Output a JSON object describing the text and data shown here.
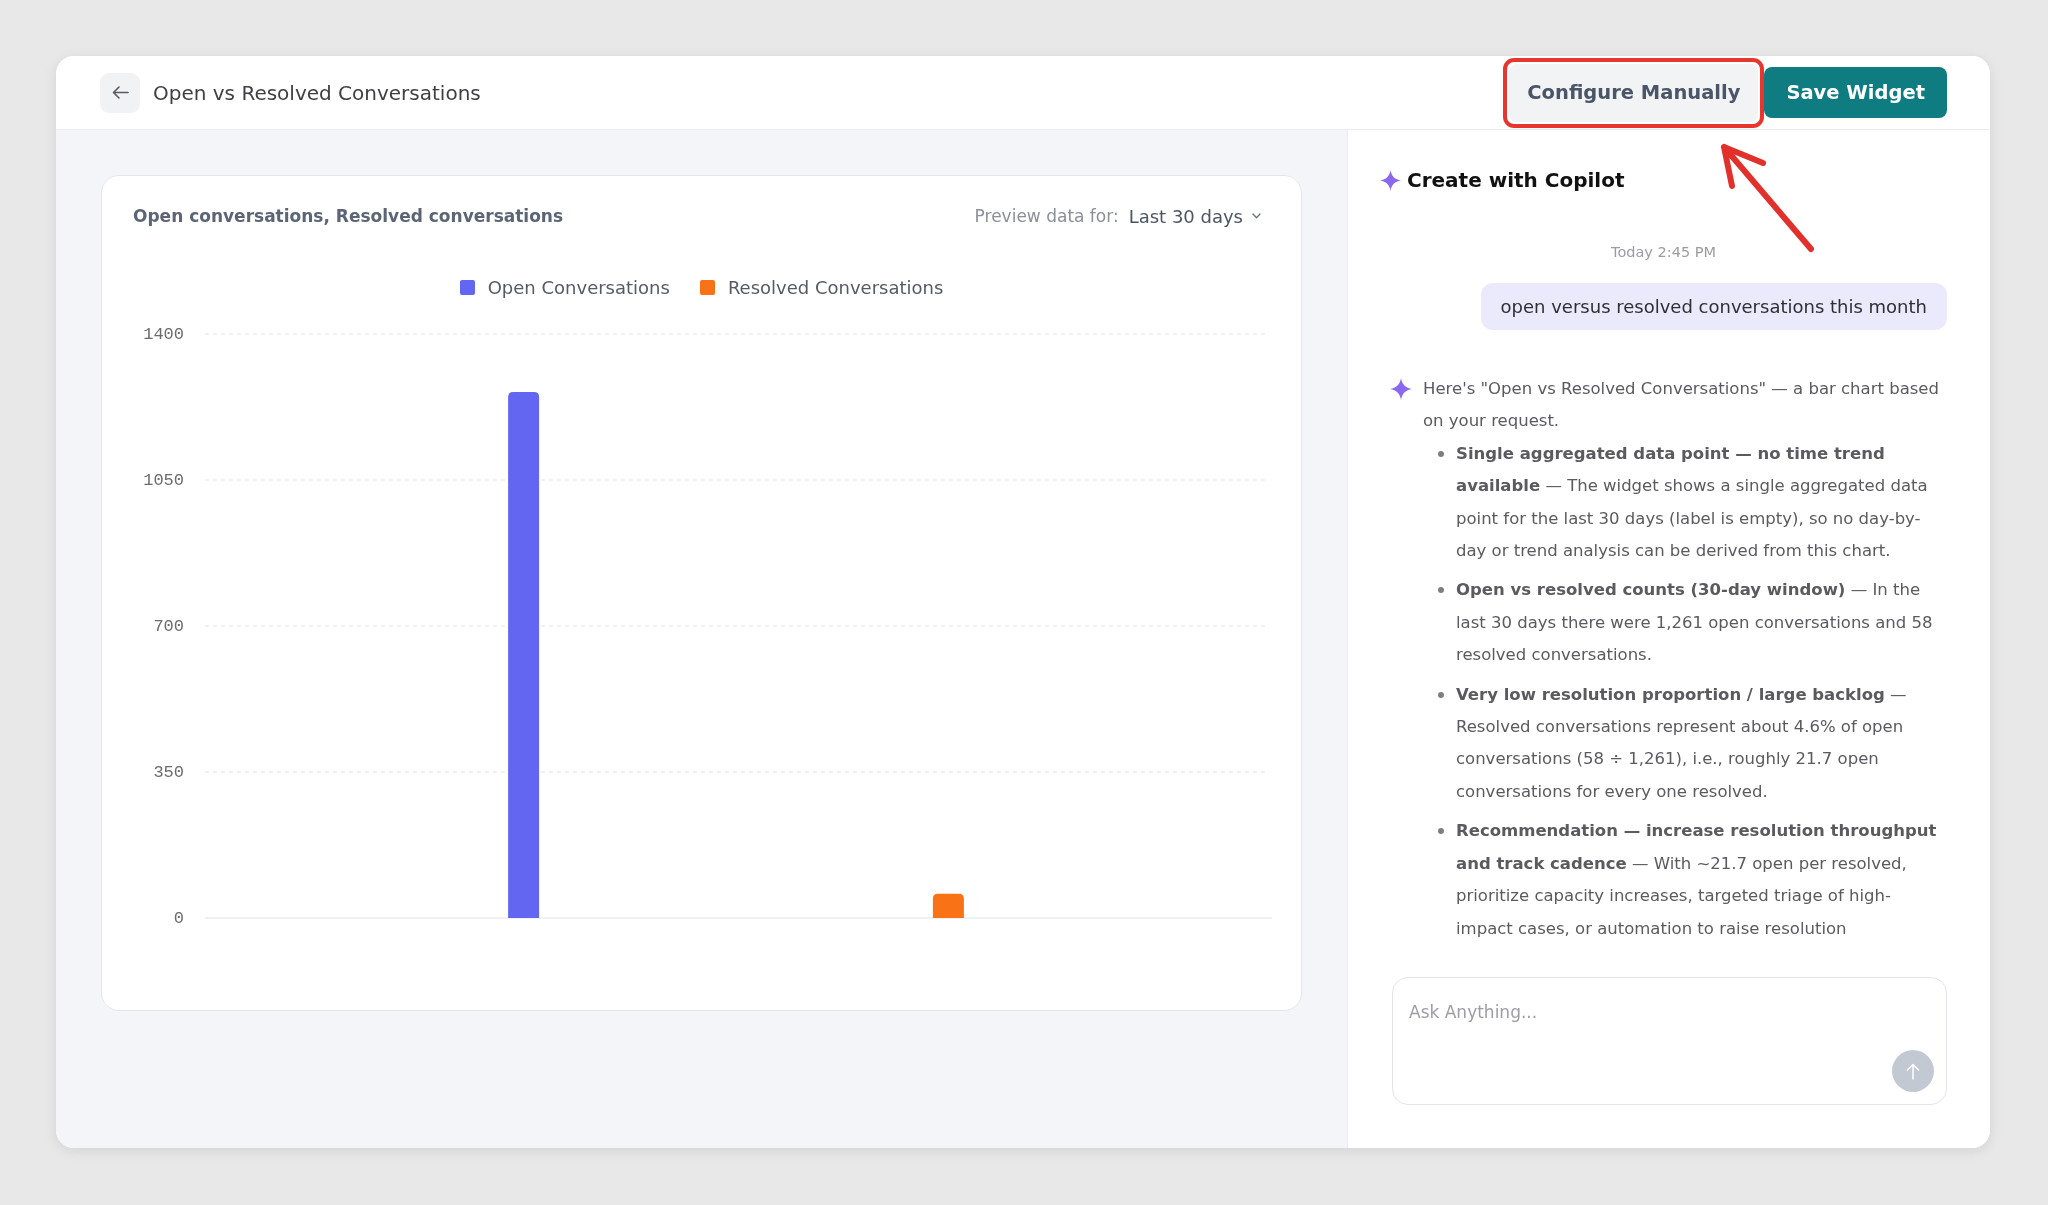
{
  "header": {
    "title": "Open vs Resolved Conversations",
    "buttons": [
      {
        "label": "Configure Manually",
        "kind": "secondary",
        "highlighted": true
      },
      {
        "label": "Save Widget",
        "kind": "primary",
        "highlighted": false
      }
    ]
  },
  "chart_panel": {
    "preview_label": "Preview data for:",
    "preview_value": "Last 30 days",
    "chart_data": {
      "type": "bar",
      "title": "Open conversations, Resolved conversations",
      "series": [
        {
          "name": "Open Conversations",
          "color": "#6366f1",
          "values": [
            1261
          ]
        },
        {
          "name": "Resolved Conversations",
          "color": "#f97316",
          "values": [
            58
          ]
        }
      ],
      "ylim": [
        0,
        1400
      ],
      "yticks": [
        0,
        350,
        700,
        1050,
        1400
      ],
      "grid": true
    }
  },
  "copilot": {
    "title": "Create with Copilot",
    "timestamp": "Today 2:45 PM",
    "messages": [
      {
        "kind": "user",
        "text": "open versus resolved conversations this month"
      },
      {
        "kind": "assistant",
        "intro": "Here's \"Open vs Resolved Conversations\" — a bar chart based on your request.",
        "bullets": [
          "**Single aggregated data point — no time trend available** — The widget shows a single aggregated data point for the last 30 days (label is empty), so no day-by-day or trend analysis can be derived from this chart.",
          "**Open vs resolved counts (30-day window)** — In the last 30 days there were 1,261 open conversations and 58 resolved conversations.",
          "**Very low resolution proportion / large backlog** — Resolved conversations represent about 4.6% of open conversations (58 ÷ 1,261), i.e., roughly 21.7 open conversations for every one resolved.",
          "**Recommendation — increase resolution throughput and track cadence** — With ~21.7 open per resolved, prioritize capacity increases, targeted triage of high-impact cases, or automation to raise resolution"
        ]
      }
    ],
    "input": {
      "placeholder": "Ask Anything...",
      "send_button": {
        "disabled": true
      }
    }
  }
}
